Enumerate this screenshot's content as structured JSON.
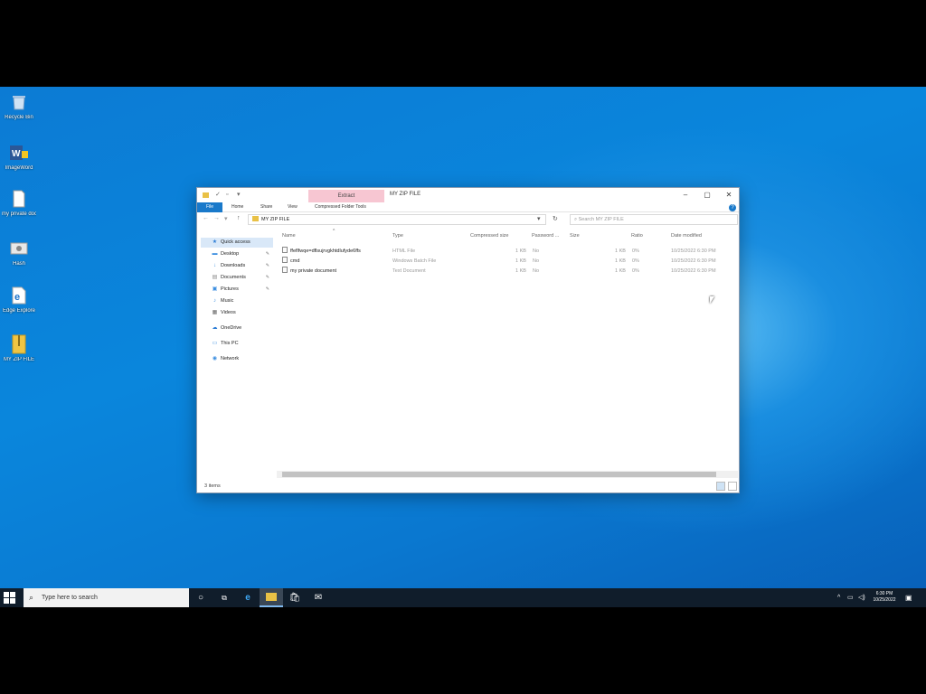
{
  "desktop": {
    "icons": [
      {
        "label": "Recycle Bin",
        "icon": "recycle-bin-icon"
      },
      {
        "label": "ImageWord",
        "icon": "word-icon"
      },
      {
        "label": "my private document",
        "icon": "document-icon"
      },
      {
        "label": "Hash",
        "icon": "program-icon"
      },
      {
        "label": "Edge Explore",
        "icon": "edge-icon"
      },
      {
        "label": "MY ZIP FILE",
        "icon": "zip-folder-icon"
      }
    ]
  },
  "explorer": {
    "title": "MY ZIP FILE",
    "contextual_tab": "Extract",
    "ribbon_tabs": [
      "File",
      "Home",
      "Share",
      "View",
      "Compressed Folder Tools"
    ],
    "address": "MY ZIP FILE",
    "search_placeholder": "Search MY ZIP FILE",
    "columns": [
      "Name",
      "Type",
      "Compressed size",
      "Password ...",
      "Size",
      "Ratio",
      "Date modified"
    ],
    "files": [
      {
        "name": "ffeflfwqe=dflsujrvgkhtdlufyde6ffs",
        "type": "HTML File",
        "compressed": "1 KB",
        "password": "No",
        "size": "1 KB",
        "ratio": "0%",
        "date": "10/25/2022 6:30 PM"
      },
      {
        "name": "cmd",
        "type": "Windows Batch File",
        "compressed": "1 KB",
        "password": "No",
        "size": "1 KB",
        "ratio": "0%",
        "date": "10/25/2022 6:30 PM"
      },
      {
        "name": "my private document",
        "type": "Text Document",
        "compressed": "1 KB",
        "password": "No",
        "size": "1 KB",
        "ratio": "0%",
        "date": "10/25/2022 6:30 PM"
      }
    ],
    "nav": [
      {
        "label": "Quick access",
        "icon": "star-icon",
        "pinned": false,
        "selected": true
      },
      {
        "label": "Desktop",
        "icon": "desktop-icon",
        "pinned": true
      },
      {
        "label": "Downloads",
        "icon": "download-icon",
        "pinned": true
      },
      {
        "label": "Documents",
        "icon": "documents-icon",
        "pinned": true
      },
      {
        "label": "Pictures",
        "icon": "pictures-icon",
        "pinned": true
      },
      {
        "label": "Music",
        "icon": "music-icon",
        "pinned": false
      },
      {
        "label": "Videos",
        "icon": "videos-icon",
        "pinned": false
      },
      {
        "label": "OneDrive",
        "icon": "cloud-icon",
        "pinned": false
      },
      {
        "label": "This PC",
        "icon": "computer-icon",
        "pinned": false
      },
      {
        "label": "Network",
        "icon": "network-icon",
        "pinned": false
      }
    ],
    "status": "3 items"
  },
  "taskbar": {
    "search_placeholder": "Type here to search",
    "time": "6:30 PM",
    "date": "10/25/2022"
  }
}
